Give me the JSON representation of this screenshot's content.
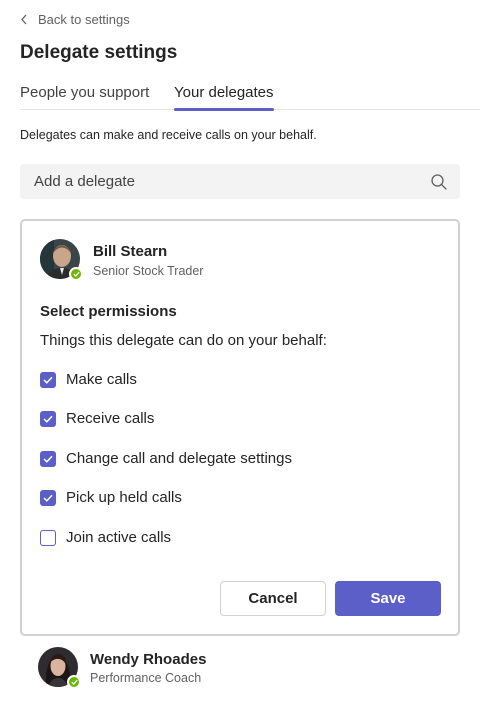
{
  "nav": {
    "back_label": "Back to settings"
  },
  "page": {
    "title": "Delegate settings"
  },
  "tabs": [
    {
      "label": "People you support",
      "active": false
    },
    {
      "label": "Your delegates",
      "active": true
    }
  ],
  "description": "Delegates can make and receive calls on your behalf.",
  "search": {
    "placeholder": "Add a delegate",
    "icon": "search-icon"
  },
  "delegate_card": {
    "name": "Bill Stearn",
    "role": "Senior Stock Trader",
    "presence": "available",
    "permissions_title": "Select permissions",
    "permissions_subtitle": "Things this delegate can do on your behalf:",
    "permissions": [
      {
        "label": "Make calls",
        "checked": true
      },
      {
        "label": "Receive calls",
        "checked": true
      },
      {
        "label": "Change call and delegate settings",
        "checked": true
      },
      {
        "label": "Pick up held calls",
        "checked": true
      },
      {
        "label": "Join active calls",
        "checked": false
      }
    ],
    "cancel_label": "Cancel",
    "save_label": "Save"
  },
  "other_delegate": {
    "name": "Wendy Rhoades",
    "role": "Performance Coach",
    "presence": "available"
  },
  "colors": {
    "accent": "#5b5fc7",
    "presence_available": "#6bb700"
  }
}
